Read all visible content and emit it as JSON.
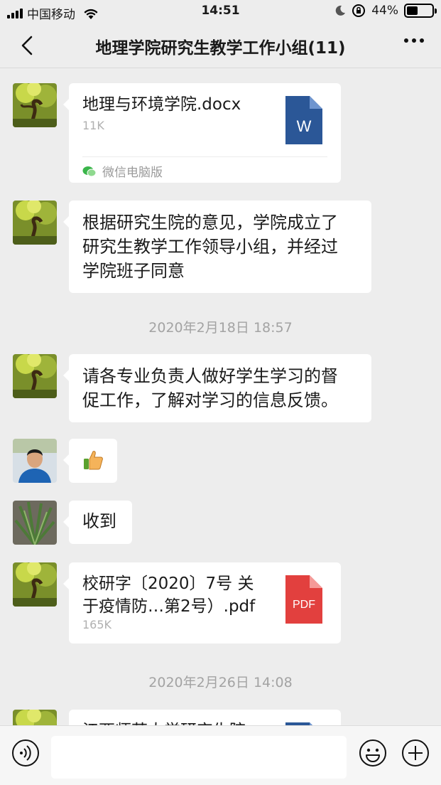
{
  "status_bar": {
    "carrier": "中国移动",
    "time": "14:51",
    "battery": "44%",
    "battery_level": 0.44
  },
  "header": {
    "title": "地理学院研究生教学工作小组(11)"
  },
  "messages": [
    {
      "type": "file",
      "filename": "地理与环境学院.docx",
      "size": "11K",
      "file_type": "W",
      "source": "微信电脑版"
    },
    {
      "type": "text",
      "lines": [
        "根据研究生院的意见，学院成立了",
        "研究生教学工作领导小组，并经过",
        "学院班子同意"
      ]
    },
    {
      "type": "timestamp",
      "text": "2020年2月18日 18:57"
    },
    {
      "type": "text",
      "lines": [
        "请各专业负责人做好学生学习的督",
        "促工作，了解对学习的信息反馈。"
      ]
    },
    {
      "type": "emoji",
      "emoji": "👍"
    },
    {
      "type": "text",
      "text": "收到"
    },
    {
      "type": "file",
      "filename_lines": [
        "校研字〔2020〕7号 关",
        "于疫情防…第2号）.pdf"
      ],
      "size": "165K",
      "file_type": "PDF"
    },
    {
      "type": "timestamp",
      "text": "2020年2月26日 14:08"
    },
    {
      "type": "file",
      "partial_text": "江西师范大学研究生院",
      "file_type": "W"
    }
  ],
  "icons": {
    "back": "chevron-left-icon",
    "more": "more-icon",
    "voice": "voice-icon",
    "emoji": "emoji-icon",
    "add": "add-icon"
  },
  "colors": {
    "word_blue": "#2b5797",
    "pdf_red": "#e2403e",
    "background": "#ededed"
  }
}
